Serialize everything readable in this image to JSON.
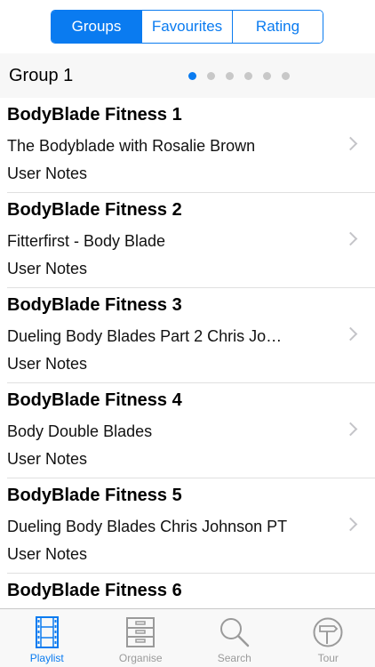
{
  "segments": {
    "items": [
      {
        "label": "Groups",
        "active": true
      },
      {
        "label": "Favourites",
        "active": false
      },
      {
        "label": "Rating",
        "active": false
      }
    ]
  },
  "group": {
    "title": "Group 1",
    "page_count": 6,
    "current_page": 1
  },
  "rows": [
    {
      "title": "BodyBlade Fitness 1",
      "subtitle": "The Bodyblade with Rosalie Brown",
      "notes": "User Notes"
    },
    {
      "title": "BodyBlade Fitness 2",
      "subtitle": "Fitterfirst - Body Blade",
      "notes": "User Notes"
    },
    {
      "title": "BodyBlade Fitness 3",
      "subtitle": "Dueling Body Blades Part 2  Chris Jo…",
      "notes": "User Notes"
    },
    {
      "title": "BodyBlade Fitness 4",
      "subtitle": "Body Double Blades",
      "notes": "User Notes"
    },
    {
      "title": "BodyBlade Fitness 5",
      "subtitle": "Dueling Body Blades Chris Johnson PT",
      "notes": "User Notes"
    },
    {
      "title": "BodyBlade Fitness 6",
      "subtitle": "",
      "notes": ""
    }
  ],
  "tabbar": {
    "tabs": [
      {
        "label": "Playlist",
        "icon": "film-strip-icon",
        "active": true
      },
      {
        "label": "Organise",
        "icon": "cabinet-icon",
        "active": false
      },
      {
        "label": "Search",
        "icon": "magnifier-icon",
        "active": false
      },
      {
        "label": "Tour",
        "icon": "signpost-icon",
        "active": false
      }
    ]
  },
  "colors": {
    "accent": "#0a7bf0",
    "inactive": "#9a9a9a"
  }
}
